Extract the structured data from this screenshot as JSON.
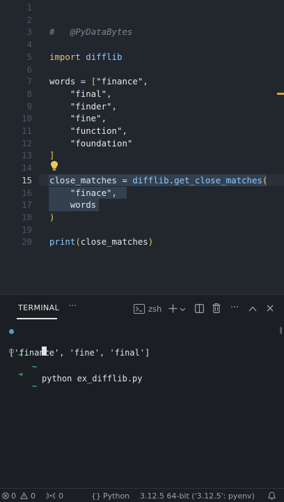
{
  "editor": {
    "lines": [
      {
        "n": "1"
      },
      {
        "n": "2"
      },
      {
        "n": "3"
      },
      {
        "n": "4"
      },
      {
        "n": "5"
      },
      {
        "n": "6"
      },
      {
        "n": "7"
      },
      {
        "n": "8"
      },
      {
        "n": "9"
      },
      {
        "n": "10"
      },
      {
        "n": "11"
      },
      {
        "n": "12"
      },
      {
        "n": "13"
      },
      {
        "n": "14"
      },
      {
        "n": "15"
      },
      {
        "n": "16"
      },
      {
        "n": "17"
      },
      {
        "n": "18"
      },
      {
        "n": "19"
      },
      {
        "n": "20"
      }
    ],
    "code": {
      "comment_hash": "#",
      "comment_text": "@PyDataBytes",
      "import_kw": "import",
      "import_mod": "difflib",
      "words_var": "words",
      "eq": " = ",
      "open_bracket": "[",
      "w1": "\"finance\"",
      "w2": "\"final\"",
      "w3": "\"finder\"",
      "w4": "\"fine\"",
      "w5": "\"function\"",
      "w6": "\"foundation\"",
      "comma": ",",
      "close_bracket": "]",
      "cm_var": "close_matches",
      "cm_mod": "difflib",
      "dot": ".",
      "cm_fn": "get_close_matches",
      "open_paren": "(",
      "arg1": "\"finace\"",
      "arg2": "words",
      "close_paren": ")",
      "print_fn": "print",
      "print_arg": "close_matches"
    }
  },
  "panel": {
    "tab_label": "TERMINAL",
    "more": "···",
    "shell_name": "zsh",
    "terminal": {
      "prompt_arrow": "➜",
      "prompt_tilde": "~",
      "command": "python ex_difflib.py",
      "output": "['finance', 'fine', 'final']"
    }
  },
  "statusbar": {
    "errors": "0",
    "warnings": "0",
    "ports": "0",
    "language_braces": "{}",
    "language": "Python",
    "interpreter": "3.12.5 64-bit ('3.12.5': pyenv)"
  },
  "icons": {
    "terminal": "terminal-icon",
    "add": "plus-icon",
    "chevron": "chevron-down-icon",
    "split": "split-icon",
    "trash": "trash-icon",
    "more": "ellipsis-icon",
    "maximize": "chevron-up-icon",
    "close": "close-icon",
    "bulb": "lightbulb-icon",
    "bell": "bell-icon"
  },
  "colors": {
    "accent": "#4f9fd6",
    "prompt_green": "#3fb950",
    "bracket_yellow": "#f2c94c"
  }
}
